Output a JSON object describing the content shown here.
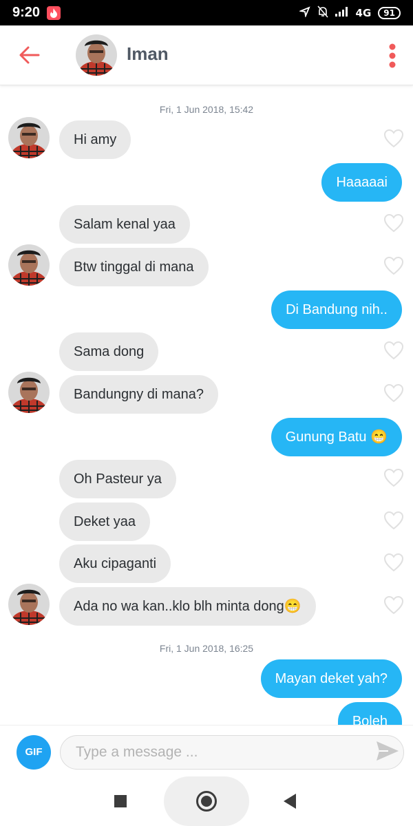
{
  "status_bar": {
    "time": "9:20",
    "network": "4G",
    "battery": "91"
  },
  "header": {
    "contact_name": "Iman"
  },
  "messages": [
    {
      "type": "timestamp",
      "date": "Fri, 1 Jun 2018,",
      "time": "15:42"
    },
    {
      "from": "them",
      "text": "Hi amy"
    },
    {
      "from": "me",
      "text": "Haaaaai"
    },
    {
      "from": "them",
      "text": "Salam kenal yaa"
    },
    {
      "from": "them",
      "text": "Btw tinggal di mana"
    },
    {
      "from": "me",
      "text": "Di Bandung nih.."
    },
    {
      "from": "them",
      "text": "Sama dong"
    },
    {
      "from": "them",
      "text": "Bandungny di mana?"
    },
    {
      "from": "me",
      "text": "Gunung Batu 😁"
    },
    {
      "from": "them",
      "text": "Oh Pasteur ya"
    },
    {
      "from": "them",
      "text": "Deket yaa"
    },
    {
      "from": "them",
      "text": "Aku cipaganti"
    },
    {
      "from": "them",
      "text": "Ada no wa kan..klo blh minta dong😁"
    },
    {
      "type": "timestamp",
      "date": "Fri, 1 Jun 2018,",
      "time": "16:25"
    },
    {
      "from": "me",
      "text": "Mayan deket yah?"
    },
    {
      "from": "me",
      "text": "Boleh"
    }
  ],
  "composer": {
    "gif_label": "GIF",
    "placeholder": "Type a message ..."
  },
  "colors": {
    "accent": "#26b6f5",
    "incoming_bubble": "#e9e9e9",
    "brand": "#ff4f5e"
  },
  "icons": [
    "back-arrow-icon",
    "more-vertical-icon",
    "heart-icon",
    "send-icon",
    "gif-icon",
    "nav-recents-icon",
    "nav-home-icon",
    "nav-back-icon"
  ]
}
